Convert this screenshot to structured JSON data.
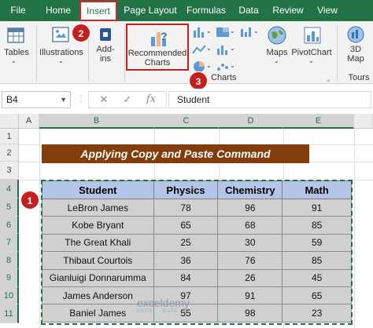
{
  "ribbon_tabs": [
    {
      "label": "File"
    },
    {
      "label": "Home"
    },
    {
      "label": "Insert"
    },
    {
      "label": "Page Layout"
    },
    {
      "label": "Formulas"
    },
    {
      "label": "Data"
    },
    {
      "label": "Review"
    },
    {
      "label": "View"
    }
  ],
  "ribbon": {
    "tables_label": "Tables",
    "illustrations_label": "Illustrations",
    "addins_label": "Add-\nins",
    "recommended_charts_label": "Recommended\nCharts",
    "maps_label": "Maps",
    "pivotchart_label": "PivotChart",
    "map3d_label": "3D\nMap",
    "charts_group_label": "Charts",
    "tours_group_label": "Tours"
  },
  "badges": {
    "insert": "2",
    "charts": "3",
    "selection": "1"
  },
  "formula_bar": {
    "name_box": "B4",
    "cancel": "✕",
    "enter": "✓",
    "fx": "fx",
    "content": "Student"
  },
  "columns": [
    "A",
    "B",
    "C",
    "D",
    "E"
  ],
  "rows": [
    "1",
    "2",
    "3",
    "4",
    "5",
    "6",
    "7",
    "8",
    "9",
    "10",
    "11"
  ],
  "sheet_title": "Applying Copy and Paste Command",
  "table": {
    "headers": [
      "Student",
      "Physics",
      "Chemistry",
      "Math"
    ],
    "rows": [
      [
        "LeBron James",
        "78",
        "96",
        "91"
      ],
      [
        "Kobe Bryant",
        "65",
        "68",
        "85"
      ],
      [
        "The Great Khali",
        "25",
        "30",
        "59"
      ],
      [
        "Thibaut Courtois",
        "36",
        "76",
        "85"
      ],
      [
        "Gianluigi Donnarumma",
        "84",
        "26",
        "45"
      ],
      [
        "James Anderson",
        "97",
        "91",
        "65"
      ],
      [
        "Baniel James",
        "55",
        "98",
        "23"
      ]
    ]
  },
  "watermark": {
    "brand": "exceldemy",
    "tagline": "EXCEL · DATA · BI"
  },
  "colors": {
    "excel_green": "#217346",
    "title_fill": "#833c0b",
    "header_fill": "#b4c6e7",
    "cell_fill": "#d0d0d0",
    "callout_red": "#c71e1e"
  }
}
